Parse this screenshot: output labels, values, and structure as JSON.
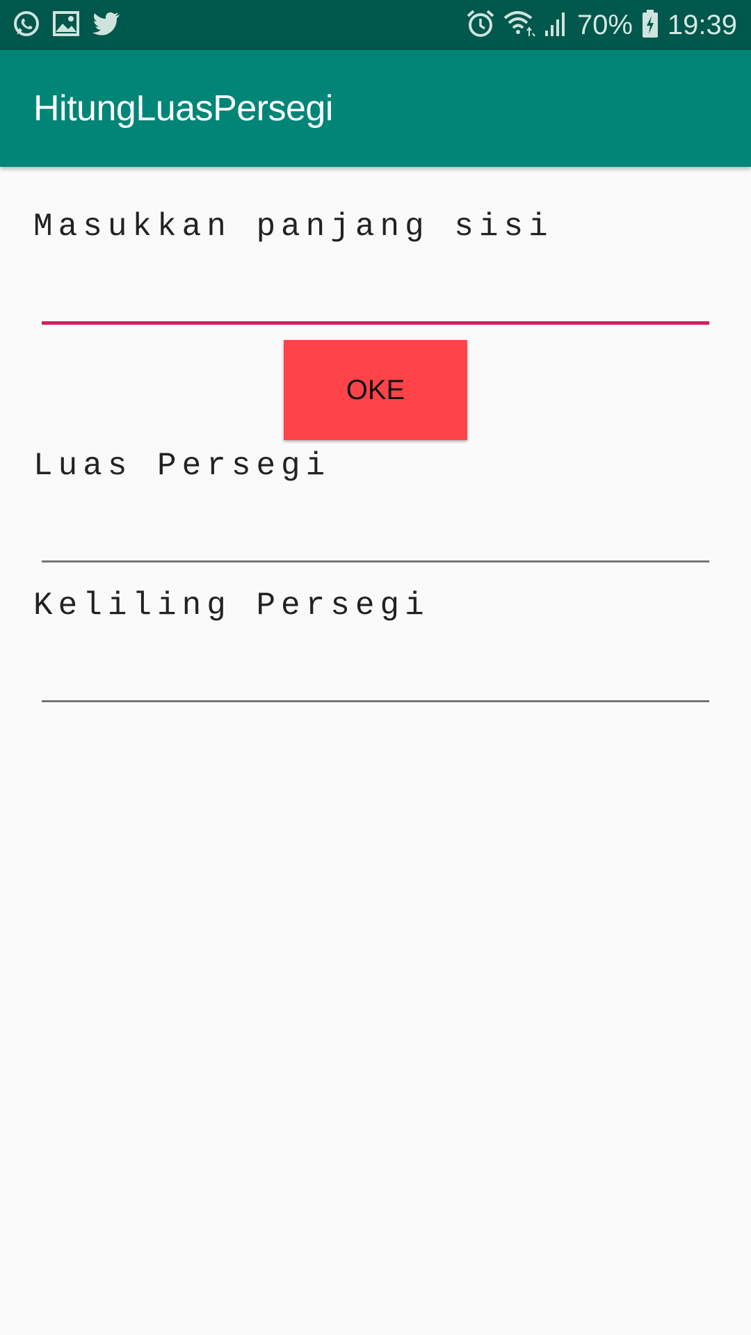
{
  "status_bar": {
    "left_icons": [
      "whatsapp-icon",
      "gallery-icon",
      "twitter-icon"
    ],
    "right_icons": [
      "alarm-icon",
      "wifi-icon",
      "signal-icon",
      "battery-charging-icon"
    ],
    "battery": "70%",
    "time": "19:39",
    "colors": {
      "background": "#00574b"
    }
  },
  "app_bar": {
    "title": "HitungLuasPersegi",
    "color": "#008577"
  },
  "form": {
    "side_input": {
      "label": "Masukkan panjang sisi",
      "value": "",
      "underline_color": "#d81b60"
    },
    "ok_button": {
      "label": "OKE",
      "color": "#ff4449"
    },
    "area_field": {
      "label": "Luas Persegi",
      "value": ""
    },
    "perimeter_field": {
      "label": "Keliling Persegi",
      "value": ""
    }
  }
}
